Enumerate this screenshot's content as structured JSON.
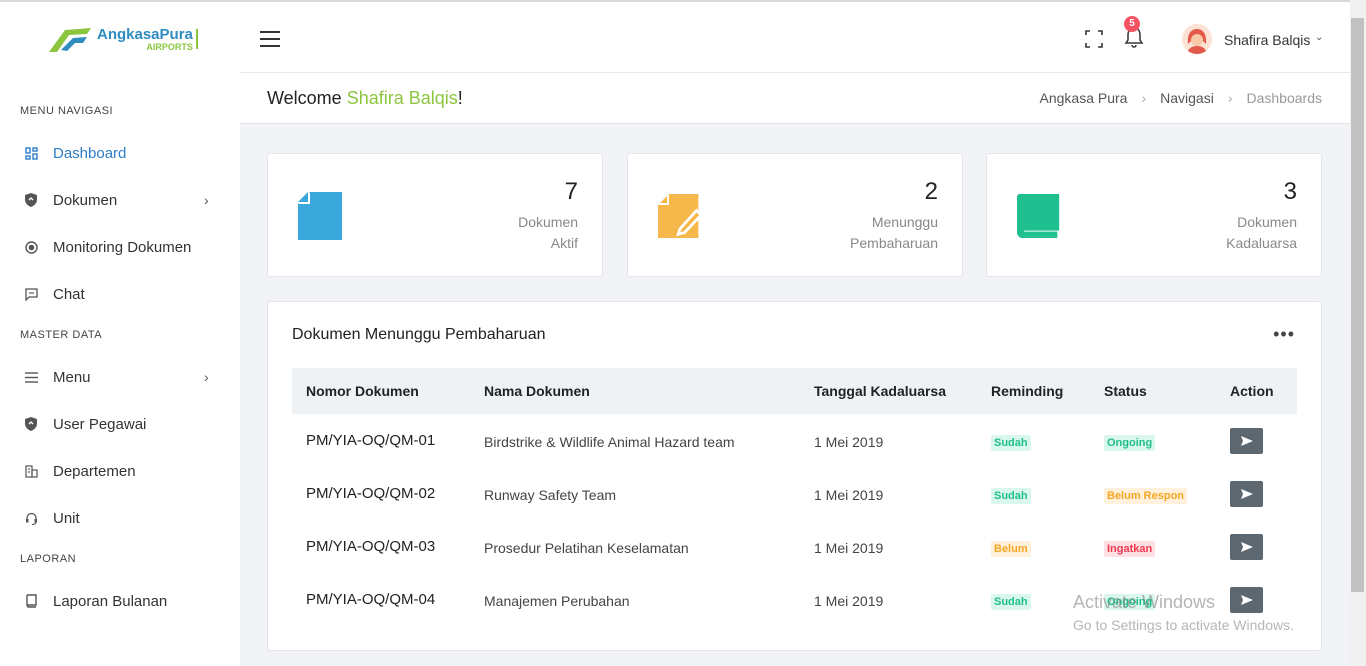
{
  "brand": {
    "name": "AngkasaPura",
    "sub": "AIRPORTS"
  },
  "sidebar": {
    "sections": [
      "MENU NAVIGASI",
      "MASTER DATA",
      "LAPORAN"
    ],
    "items": [
      {
        "label": "Dashboard",
        "icon": "dashboard-icon",
        "active": true
      },
      {
        "label": "Dokumen",
        "icon": "shield-icon",
        "has_children": true
      },
      {
        "label": "Monitoring Dokumen",
        "icon": "target-icon"
      },
      {
        "label": "Chat",
        "icon": "chat-icon"
      },
      {
        "label": "Menu",
        "icon": "list-icon",
        "has_children": true
      },
      {
        "label": "User Pegawai",
        "icon": "shield-icon"
      },
      {
        "label": "Departemen",
        "icon": "building-icon"
      },
      {
        "label": "Unit",
        "icon": "headset-icon"
      },
      {
        "label": "Laporan Bulanan",
        "icon": "book-icon"
      }
    ]
  },
  "header": {
    "notification_count": "5",
    "user_name": "Shafira Balqis"
  },
  "welcome": {
    "prefix": "Welcome ",
    "name": "Shafira Balqis",
    "suffix": "!",
    "breadcrumb": [
      "Angkasa Pura",
      "Navigasi",
      "Dashboards"
    ]
  },
  "stats": [
    {
      "value": "7",
      "label_1": "Dokumen",
      "label_2": "Aktif",
      "color": "#3aa8db"
    },
    {
      "value": "2",
      "label_1": "Menunggu",
      "label_2": "Pembaharuan",
      "color": "#f7b84b"
    },
    {
      "value": "3",
      "label_1": "Dokumen",
      "label_2": "Kadaluarsa",
      "color": "#1fbf8f"
    }
  ],
  "table": {
    "title": "Dokumen Menunggu Pembaharuan",
    "columns": [
      "Nomor Dokumen",
      "Nama Dokumen",
      "Tanggal Kadaluarsa",
      "Reminding",
      "Status",
      "Action"
    ],
    "rows": [
      {
        "nomor": "PM/YIA-OQ/QM-01",
        "nama": "Birdstrike & Wildlife Animal Hazard team",
        "tanggal": "1 Mei 2019",
        "reminding": "Sudah",
        "status": "Ongoing"
      },
      {
        "nomor": "PM/YIA-OQ/QM-02",
        "nama": "Runway Safety Team",
        "tanggal": "1 Mei 2019",
        "reminding": "Sudah",
        "status": "Belum Respon"
      },
      {
        "nomor": "PM/YIA-OQ/QM-03",
        "nama": "Prosedur Pelatihan Keselamatan",
        "tanggal": "1 Mei 2019",
        "reminding": "Belum",
        "status": "Ingatkan"
      },
      {
        "nomor": "PM/YIA-OQ/QM-04",
        "nama": "Manajemen Perubahan",
        "tanggal": "1 Mei 2019",
        "reminding": "Sudah",
        "status": "Ongoing"
      }
    ]
  },
  "watermark": {
    "title": "Activate Windows",
    "sub": "Go to Settings to activate Windows."
  }
}
